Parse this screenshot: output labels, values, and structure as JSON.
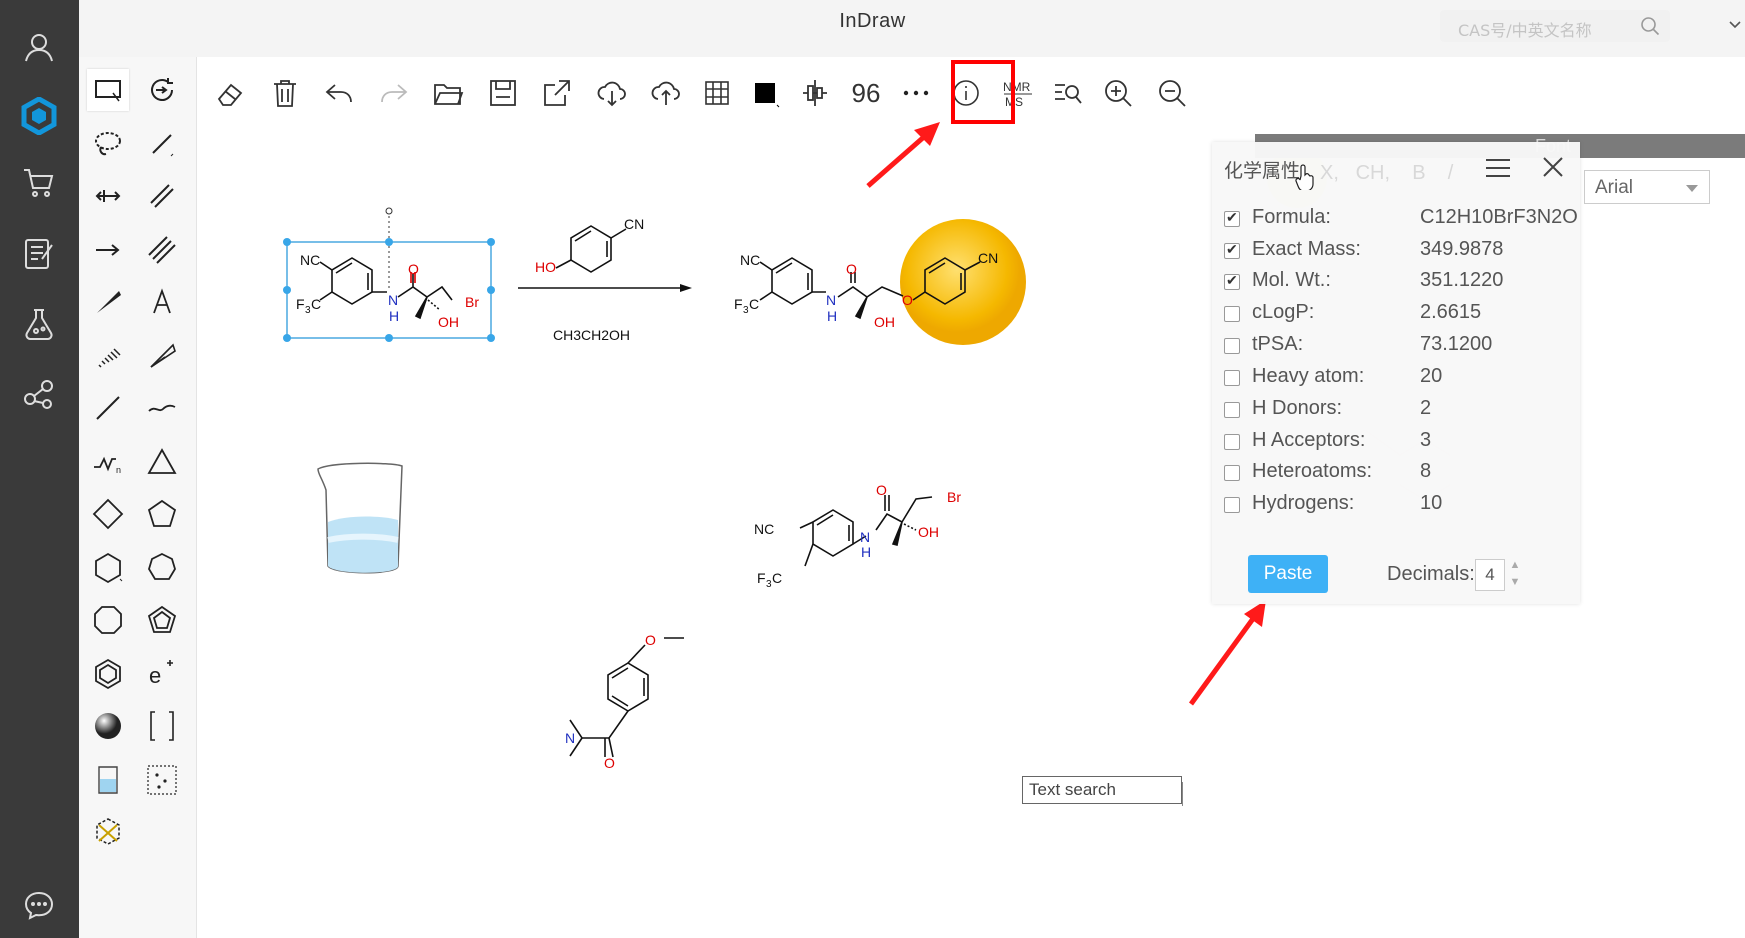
{
  "app": {
    "title": "InDraw"
  },
  "search": {
    "placeholder": "CAS号/中英文名称"
  },
  "toolbar": {
    "font_size_value": "96"
  },
  "chem_properties": {
    "title": "化学属性",
    "rows": [
      {
        "label": "Formula:",
        "value": "C12H10BrF3N2O",
        "checked": true
      },
      {
        "label": "Exact Mass:",
        "value": "349.9878",
        "checked": true
      },
      {
        "label": "Mol. Wt.:",
        "value": "351.1220",
        "checked": true
      },
      {
        "label": "cLogP:",
        "value": "2.6615",
        "checked": false
      },
      {
        "label": "tPSA:",
        "value": "73.1200",
        "checked": false
      },
      {
        "label": "Heavy atom:",
        "value": "20",
        "checked": false
      },
      {
        "label": "H Donors:",
        "value": "2",
        "checked": false
      },
      {
        "label": "H Acceptors:",
        "value": "3",
        "checked": false
      },
      {
        "label": "Heteroatoms:",
        "value": "8",
        "checked": false
      },
      {
        "label": "Hydrogens:",
        "value": "10",
        "checked": false
      }
    ],
    "paste_label": "Paste",
    "decimals_label": "Decimals:",
    "decimals_value": "4"
  },
  "font_panel": {
    "title": "Font",
    "font_name": "Arial"
  },
  "canvas": {
    "reagent_label": "CH3CH2OH",
    "text_search_label": "Text search"
  },
  "colors": {
    "accent": "#3eb1f6",
    "highlight": "#ff0000",
    "sidebar": "#3a3a3a",
    "brand": "#1296db"
  }
}
